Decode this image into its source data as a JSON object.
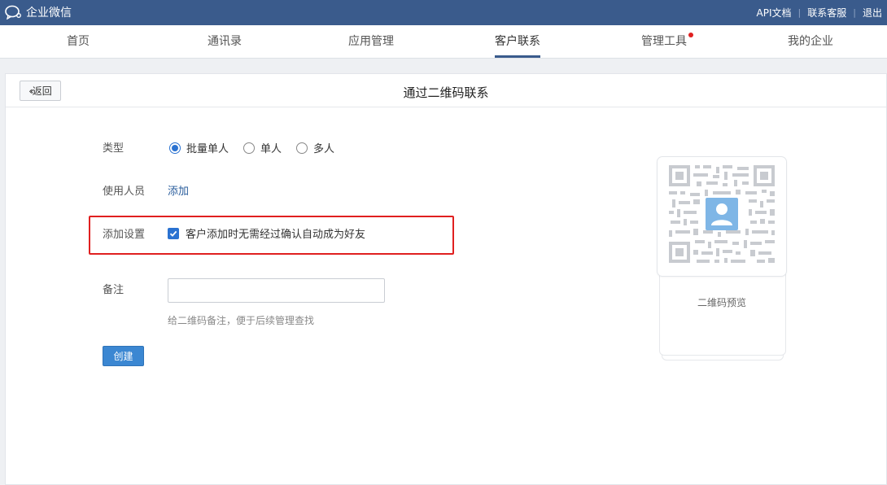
{
  "app": {
    "name": "企业微信"
  },
  "toplinks": [
    "API文档",
    "联系客服",
    "退出"
  ],
  "nav": {
    "items": [
      "首页",
      "通讯录",
      "应用管理",
      "客户联系",
      "管理工具",
      "我的企业"
    ],
    "active_index": 3,
    "badge_index": 4
  },
  "panel": {
    "back_label": "返回",
    "title": "通过二维码联系"
  },
  "form": {
    "type_label": "类型",
    "type_options": [
      "批量单人",
      "单人",
      "多人"
    ],
    "type_selected": "批量单人",
    "users_label": "使用人员",
    "users_add": "添加",
    "settings_label": "添加设置",
    "settings_checkbox_label": "客户添加时无需经过确认自动成为好友",
    "settings_checked": true,
    "note_label": "备注",
    "note_value": "",
    "note_placeholder": "",
    "note_hint": "给二维码备注，便于后续管理查找",
    "create_label": "创建"
  },
  "qr": {
    "caption": "二维码预览"
  },
  "colors": {
    "topbar": "#3a5b8c",
    "accent": "#2a72d1",
    "highlight_border": "#e02020",
    "button": "#3b87d2"
  }
}
